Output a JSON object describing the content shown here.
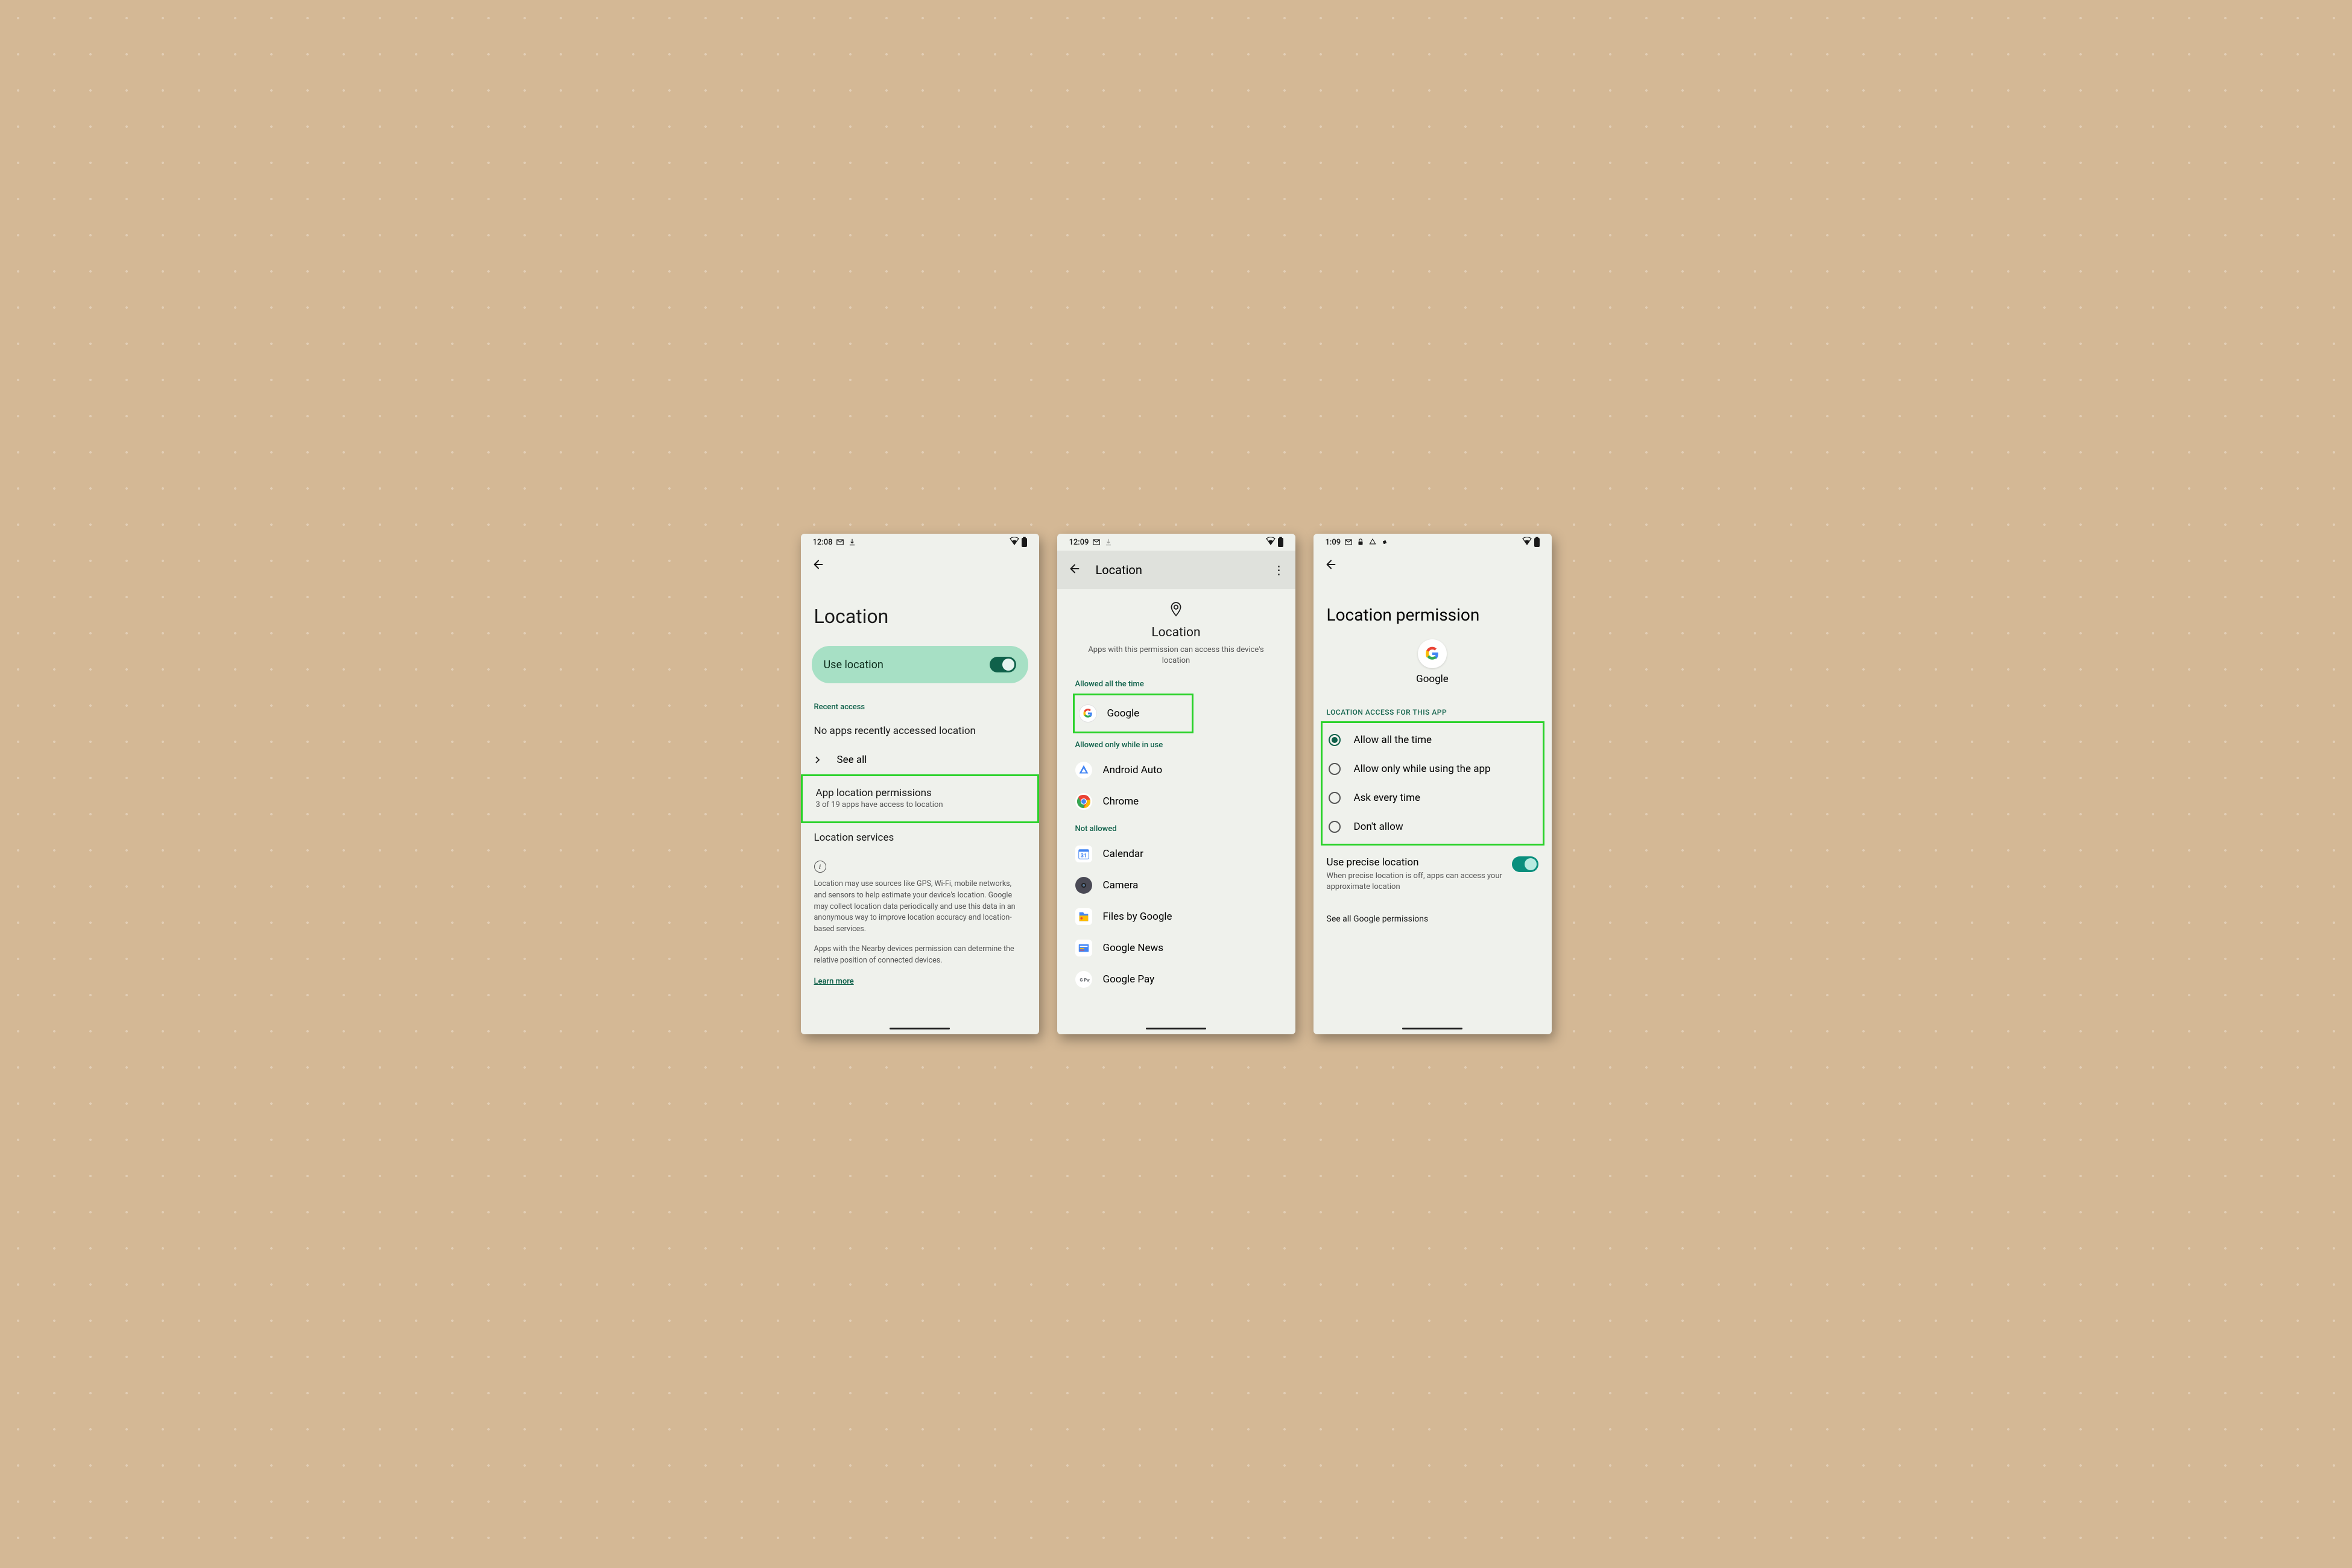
{
  "highlight_color": "#2ad22a",
  "screen1": {
    "status_time": "12:08",
    "status_icons_left": [
      "gmail",
      "download"
    ],
    "title": "Location",
    "use_location": {
      "label": "Use location",
      "on": true
    },
    "recent_label": "Recent access",
    "no_recent": "No apps recently accessed location",
    "see_all": "See all",
    "app_perms": {
      "title": "App location permissions",
      "sub": "3 of 19 apps have access to location"
    },
    "loc_services": "Location services",
    "body1": "Location may use sources like GPS, Wi-Fi, mobile networks, and sensors to help estimate your device's location. Google may collect location data periodically and use this data in an anonymous way to improve location accuracy and location-based services.",
    "body2": "Apps with the Nearby devices permission can determine the relative position of connected devices.",
    "learn_more": "Learn more"
  },
  "screen2": {
    "status_time": "12:09",
    "header_title": "Location",
    "pin_title": "Location",
    "pin_desc": "Apps with this permission can access this device's location",
    "sec_always": "Allowed all the time",
    "apps_always": [
      {
        "name": "Google",
        "icon": "google"
      }
    ],
    "sec_inuse": "Allowed only while in use",
    "apps_inuse": [
      {
        "name": "Android Auto",
        "icon": "aa"
      },
      {
        "name": "Chrome",
        "icon": "chrome"
      }
    ],
    "sec_not": "Not allowed",
    "apps_not": [
      {
        "name": "Calendar",
        "icon": "cal"
      },
      {
        "name": "Camera",
        "icon": "cam"
      },
      {
        "name": "Files by Google",
        "icon": "files"
      },
      {
        "name": "Google News",
        "icon": "news"
      },
      {
        "name": "Google Pay",
        "icon": "pay"
      }
    ]
  },
  "screen3": {
    "status_time": "1:09",
    "status_icons_left": [
      "gmail",
      "lock",
      "triangle",
      "fan"
    ],
    "title": "Location permission",
    "app_name": "Google",
    "section_label": "LOCATION ACCESS FOR THIS APP",
    "options": [
      {
        "label": "Allow all the time",
        "selected": true
      },
      {
        "label": "Allow only while using the app",
        "selected": false
      },
      {
        "label": "Ask every time",
        "selected": false
      },
      {
        "label": "Don't allow",
        "selected": false
      }
    ],
    "precise": {
      "title": "Use precise location",
      "sub": "When precise location is off, apps can access your approximate location",
      "on": true
    },
    "see_all": "See all Google permissions"
  }
}
